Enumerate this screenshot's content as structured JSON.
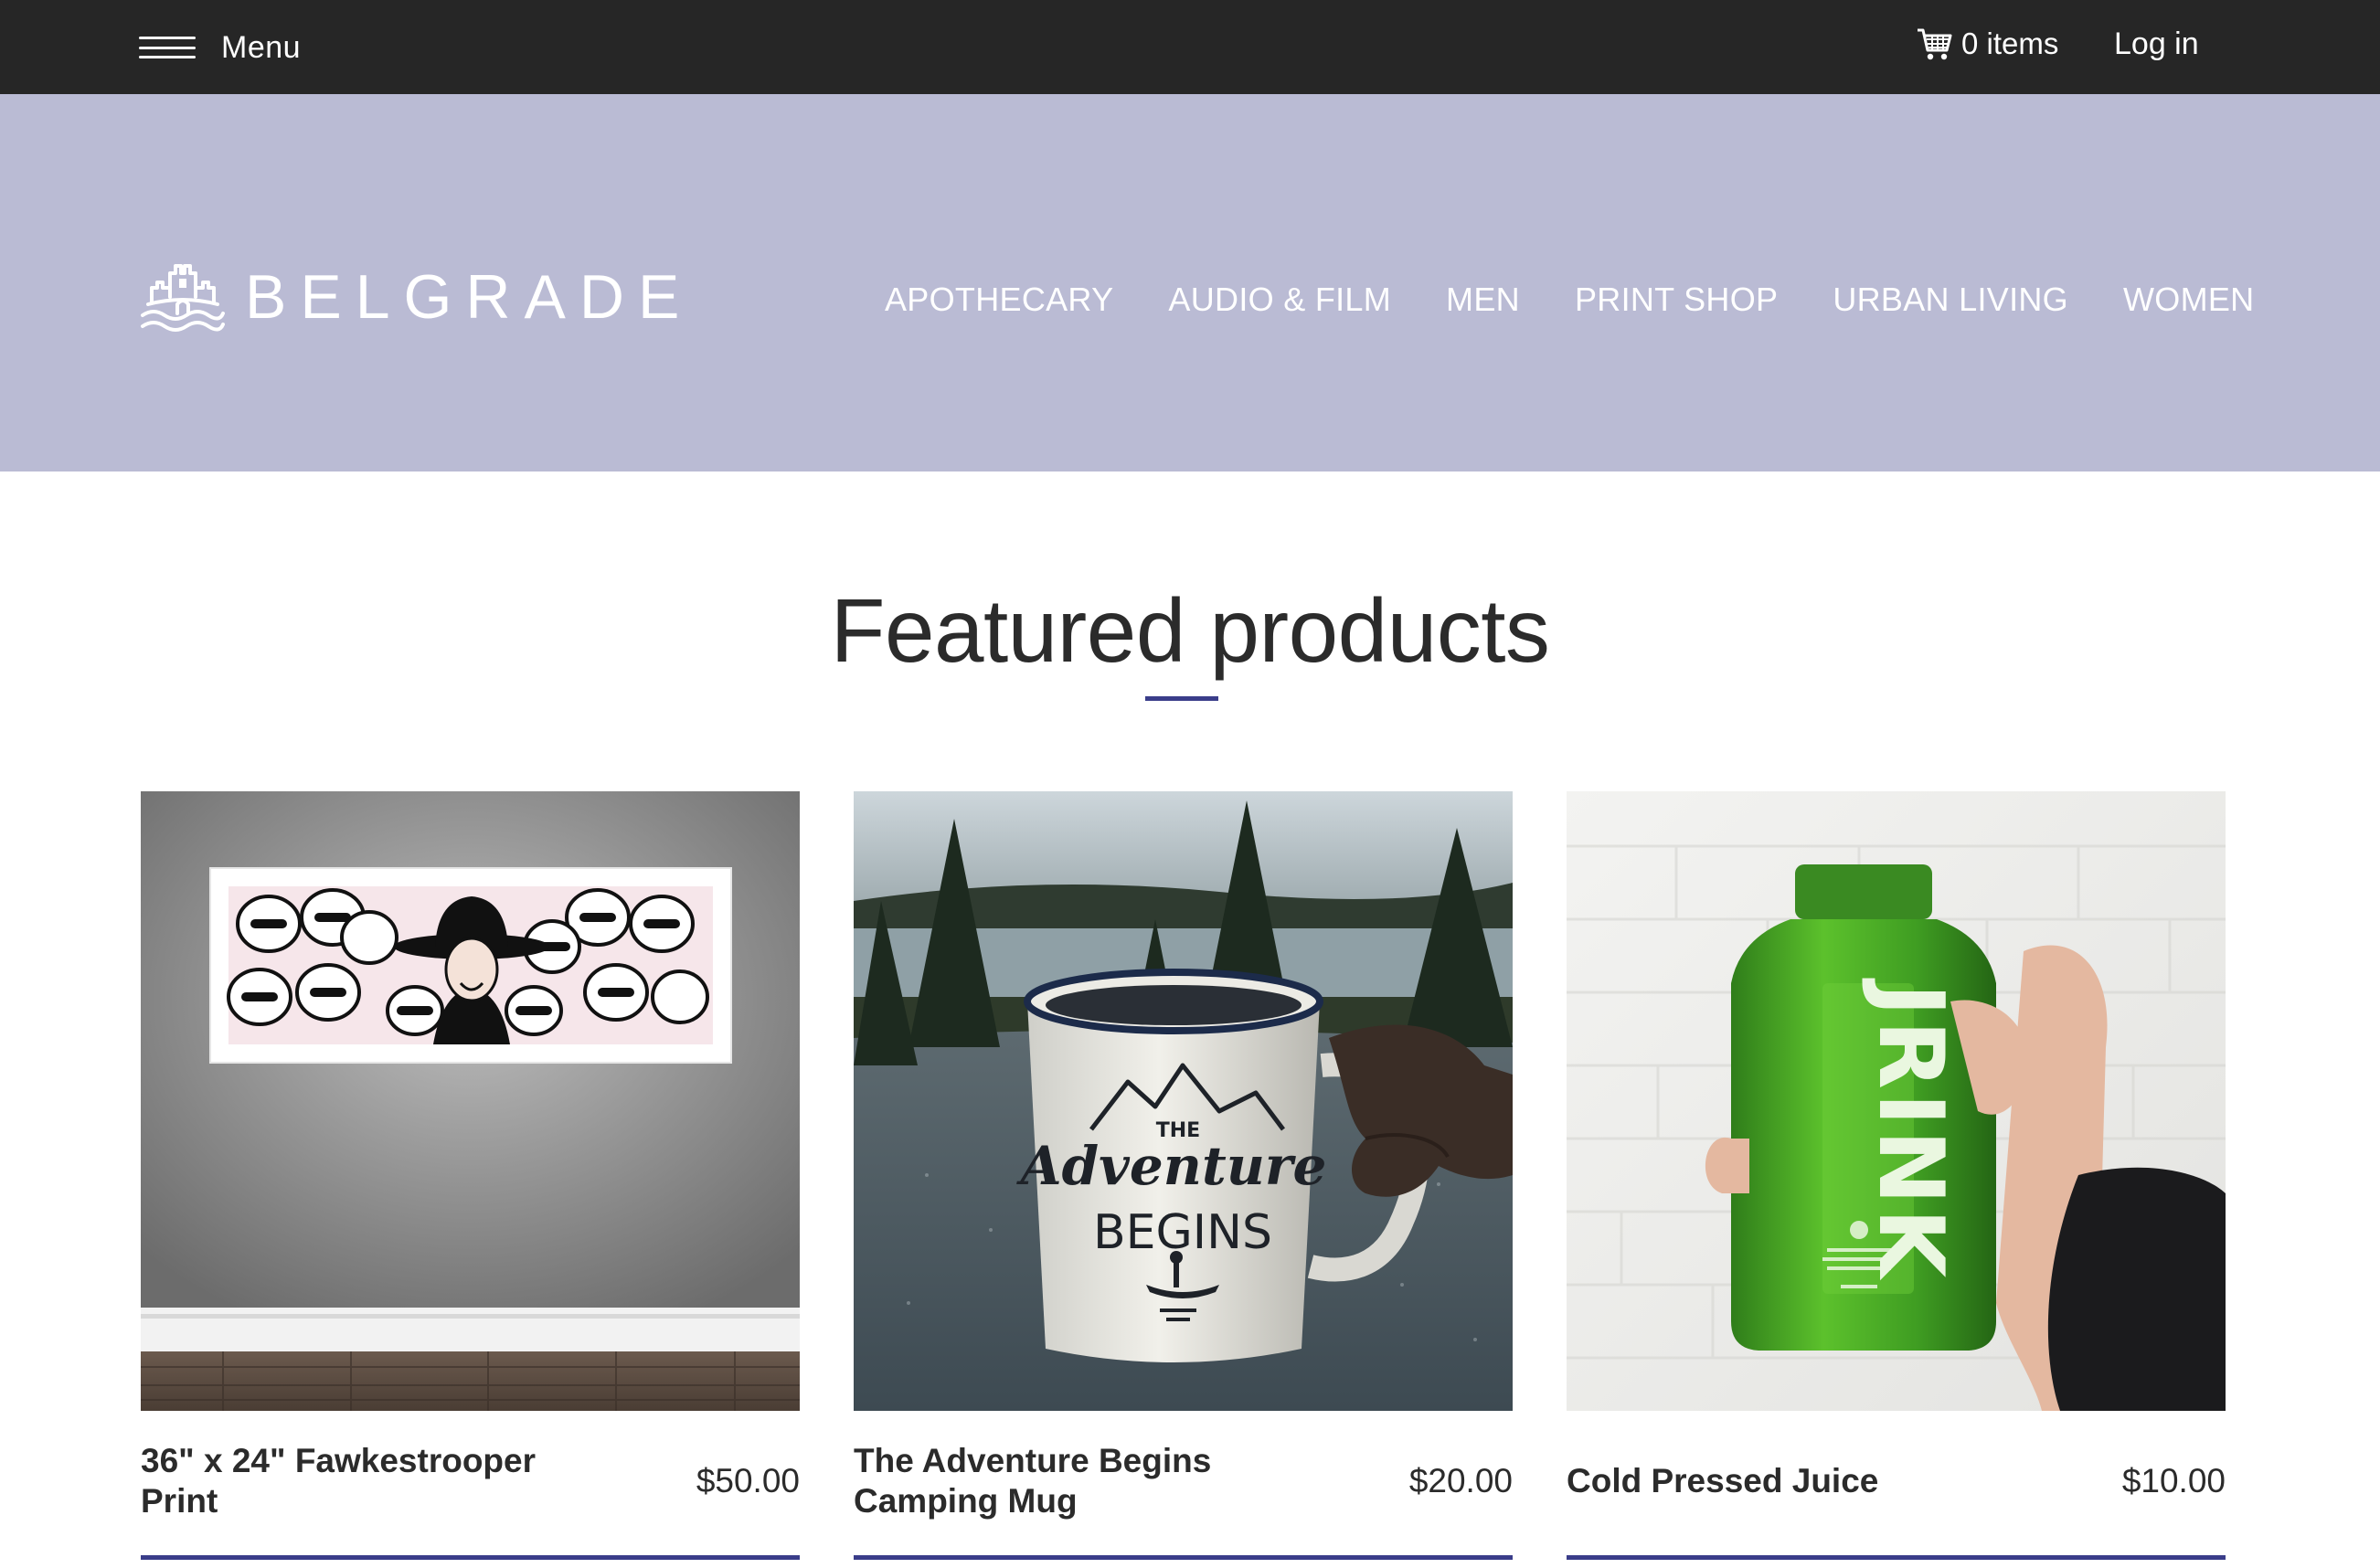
{
  "topbar": {
    "menu_label": "Menu",
    "cart_label": "0 items",
    "login_label": "Log in"
  },
  "brand": {
    "name": "BELGRADE",
    "header_color": "#babbd4",
    "accent_color": "#3a3d8a"
  },
  "nav": {
    "items": [
      {
        "label": "APOTHECARY"
      },
      {
        "label": "AUDIO & FILM"
      },
      {
        "label": "MEN"
      },
      {
        "label": "PRINT SHOP"
      },
      {
        "label": "URBAN LIVING"
      },
      {
        "label": "WOMEN"
      }
    ]
  },
  "featured": {
    "title": "Featured products",
    "products": [
      {
        "name": "36\" x 24\" Fawkestrooper Print",
        "price": "$50.00",
        "image_icon": "framed-art-print-image"
      },
      {
        "name": "The Adventure Begins Camping Mug",
        "price": "$20.00",
        "image_icon": "camping-mug-image",
        "mug_text": [
          "THE",
          "Adventure",
          "BEGINS"
        ]
      },
      {
        "name": "Cold Pressed Juice",
        "price": "$10.00",
        "image_icon": "juice-bottle-image",
        "bottle_text": "JRINK"
      }
    ]
  }
}
